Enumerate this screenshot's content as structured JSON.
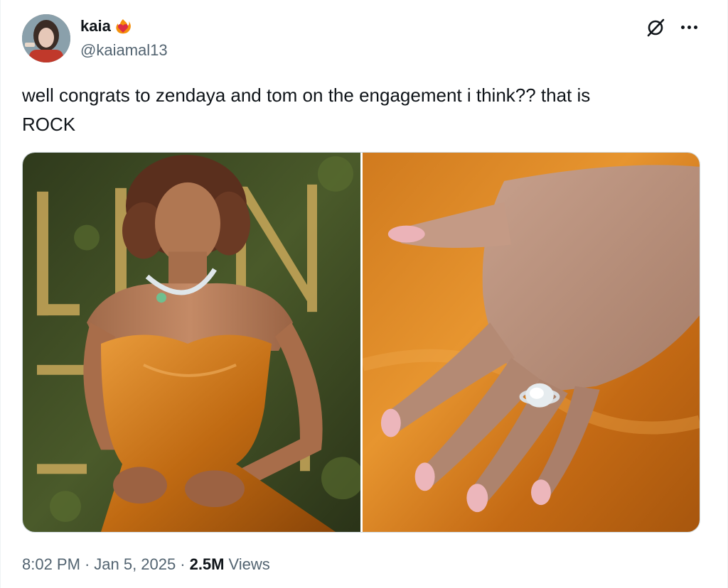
{
  "user": {
    "display_name": "kaia",
    "handle": "@kaiamal13"
  },
  "tweet": {
    "text": "well congrats to zendaya and tom on the engagement i think?? that is\nROCK"
  },
  "meta": {
    "time": "8:02 PM",
    "separator": "·",
    "date": "Jan 5, 2025",
    "views_count": "2.5M",
    "views_label": "Views"
  },
  "icons": {
    "badge": "heart-on-fire-emoji",
    "grok": "grok-icon",
    "more": "more-options-icon"
  },
  "colors": {
    "text_primary": "#0f1419",
    "text_secondary": "#536471",
    "dress_orange": "#c8741a",
    "backdrop_green": "#3d4a22",
    "nail_pink": "#e9b3b8"
  }
}
